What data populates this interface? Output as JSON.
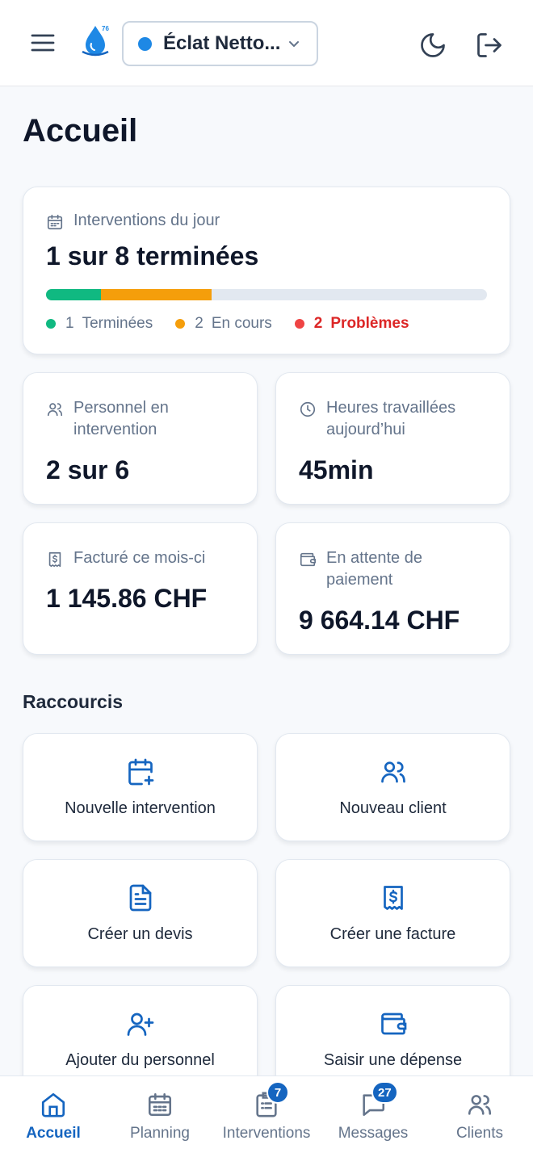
{
  "header": {
    "company_name": "Éclat Netto...",
    "company_dot_color": "#1E88E5",
    "logo_sup": "76"
  },
  "page": {
    "title": "Accueil"
  },
  "today": {
    "label": "Interventions du jour",
    "value": "1 sur 8 terminées",
    "progress": [
      {
        "status": "Terminées",
        "fraction": 0.125,
        "color": "#10B981"
      },
      {
        "status": "En cours",
        "fraction": 0.25,
        "color": "#F59E0B"
      }
    ],
    "legend": [
      {
        "count": "1",
        "label": "Terminées",
        "color": "#10B981"
      },
      {
        "count": "2",
        "label": "En cours",
        "color": "#F59E0B"
      },
      {
        "count": "2",
        "label": "Problèmes",
        "color": "#EF4444"
      }
    ]
  },
  "stats": {
    "personnel": {
      "label": "Personnel en intervention",
      "value": "2 sur 6"
    },
    "heures": {
      "label": "Heures travaillées aujourd’hui",
      "value": "45min"
    },
    "facture": {
      "label": "Facturé ce mois-ci",
      "value": "1 145.86 CHF"
    },
    "attente": {
      "label": "En attente de paiement",
      "value": "9 664.14 CHF"
    }
  },
  "shortcuts": {
    "title": "Raccourcis",
    "items": [
      {
        "label": "Nouvelle intervention",
        "icon": "calendar-plus-icon"
      },
      {
        "label": "Nouveau client",
        "icon": "users-icon"
      },
      {
        "label": "Créer un devis",
        "icon": "document-icon"
      },
      {
        "label": "Créer une facture",
        "icon": "receipt-icon"
      },
      {
        "label": "Ajouter du personnel",
        "icon": "user-plus-icon"
      },
      {
        "label": "Saisir une dépense",
        "icon": "wallet-icon"
      }
    ]
  },
  "nav": {
    "items": [
      {
        "label": "Accueil",
        "icon": "home-icon",
        "active": true
      },
      {
        "label": "Planning",
        "icon": "calendar-icon"
      },
      {
        "label": "Interventions",
        "icon": "clipboard-icon",
        "badge": "7"
      },
      {
        "label": "Messages",
        "icon": "message-icon",
        "badge": "27"
      },
      {
        "label": "Clients",
        "icon": "users-icon"
      }
    ]
  },
  "colors": {
    "accent": "#1565C0",
    "text": "#0F172A",
    "muted": "#64748B"
  }
}
